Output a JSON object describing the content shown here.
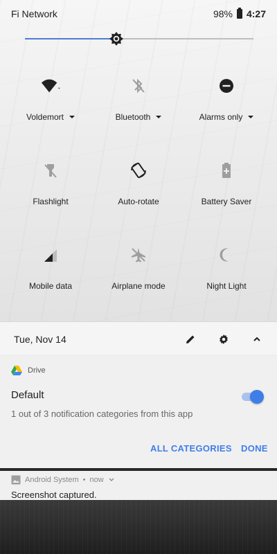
{
  "status_bar": {
    "carrier": "Fi Network",
    "battery_percent": "98%",
    "time": "4:27"
  },
  "brightness": {
    "level": 0.4,
    "icon": "brightness-icon"
  },
  "tiles": [
    {
      "label": "Voldemort",
      "icon": "wifi-icon",
      "has_dropdown": true
    },
    {
      "label": "Bluetooth",
      "icon": "bluetooth-disabled-icon",
      "has_dropdown": true
    },
    {
      "label": "Alarms only",
      "icon": "do-not-disturb-icon",
      "has_dropdown": true
    },
    {
      "label": "Flashlight",
      "icon": "flashlight-off-icon",
      "has_dropdown": false
    },
    {
      "label": "Auto-rotate",
      "icon": "auto-rotate-icon",
      "has_dropdown": false
    },
    {
      "label": "Battery Saver",
      "icon": "battery-saver-icon",
      "has_dropdown": false
    },
    {
      "label": "Mobile data",
      "icon": "mobile-signal-icon",
      "has_dropdown": false
    },
    {
      "label": "Airplane mode",
      "icon": "airplane-off-icon",
      "has_dropdown": false
    },
    {
      "label": "Night Light",
      "icon": "moon-icon",
      "has_dropdown": false
    }
  ],
  "datebar": {
    "date": "Tue, Nov 14",
    "edit_icon": "pencil-icon",
    "settings_icon": "gear-icon",
    "collapse_icon": "chevron-up-icon"
  },
  "drive_notification": {
    "app_name": "Drive",
    "title": "Default",
    "description": "1 out of 3 notification categories from this app",
    "toggle_on": true,
    "all_categories_label": "ALL CATEGORIES",
    "done_label": "DONE",
    "accent_color": "#3f7ee8"
  },
  "system_notification": {
    "app_name": "Android System",
    "separator": "•",
    "time": "now",
    "body": "Screenshot captured."
  }
}
